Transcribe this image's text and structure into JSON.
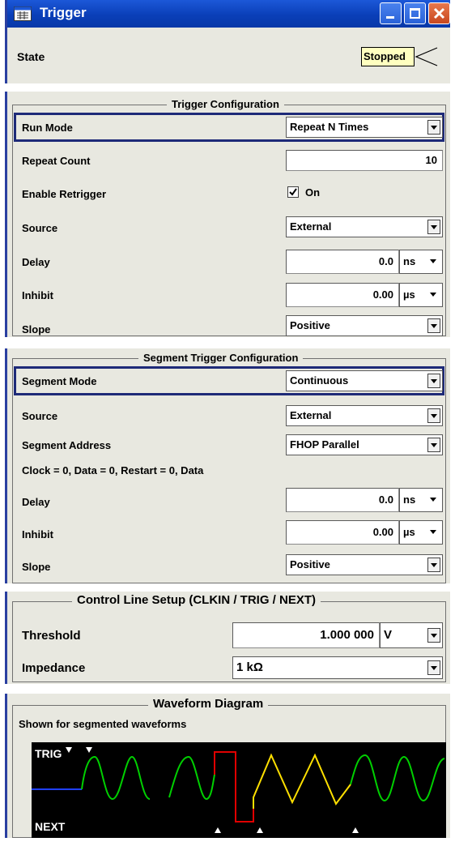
{
  "window": {
    "title": "Trigger",
    "state_label": "State",
    "state_value": "Stopped"
  },
  "trigger_config": {
    "legend": "Trigger Configuration",
    "run_mode": {
      "label": "Run Mode",
      "value": "Repeat N Times"
    },
    "repeat_count": {
      "label": "Repeat Count",
      "value": "10"
    },
    "enable_retrigger": {
      "label": "Enable Retrigger",
      "value": "On",
      "checked": true
    },
    "source": {
      "label": "Source",
      "value": "External"
    },
    "delay": {
      "label": "Delay",
      "value": "0.0",
      "unit": "ns"
    },
    "inhibit": {
      "label": "Inhibit",
      "value": "0.00",
      "unit": "µs"
    },
    "slope": {
      "label": "Slope",
      "value": "Positive"
    }
  },
  "segment_config": {
    "legend": "Segment Trigger Configuration",
    "segment_mode": {
      "label": "Segment Mode",
      "value": "Continuous"
    },
    "source": {
      "label": "Source",
      "value": "External"
    },
    "segment_address": {
      "label": "Segment Address",
      "value": "FHOP Parallel"
    },
    "info_text": "Clock = 0, Data = 0, Restart = 0, Data",
    "delay": {
      "label": "Delay",
      "value": "0.0",
      "unit": "ns"
    },
    "inhibit": {
      "label": "Inhibit",
      "value": "0.00",
      "unit": "µs"
    },
    "slope": {
      "label": "Slope",
      "value": "Positive"
    }
  },
  "control_line": {
    "legend": "Control Line Setup (CLKIN / TRIG / NEXT)",
    "threshold": {
      "label": "Threshold",
      "value": "1.000 000",
      "unit": "V"
    },
    "impedance": {
      "label": "Impedance",
      "value": "1 kΩ"
    }
  },
  "waveform": {
    "legend": "Waveform Diagram",
    "subtitle": "Shown for segmented waveforms",
    "trig_label": "TRIG",
    "next_label": "NEXT"
  },
  "colors": {
    "accent": "#2a3fa0",
    "selection": "#1e2a78",
    "wave_green": "#00d000",
    "wave_red": "#e00000",
    "wave_yellow": "#ffe000",
    "wave_blue": "#2040ff"
  },
  "icons": {
    "window_icon": "grid-window-icon",
    "state_indicator": "stopped-arrow-icon"
  }
}
